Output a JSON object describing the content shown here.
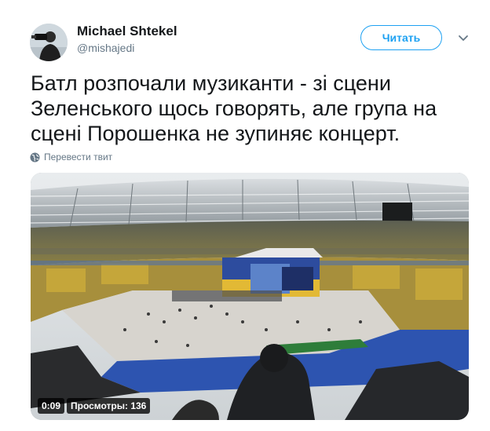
{
  "author": {
    "name": "Michael Shtekel",
    "handle": "@mishajedi"
  },
  "follow_button": {
    "label": "Читать"
  },
  "tweet": {
    "lines": [
      "Батл розпочали музиканти - зі сцени",
      "Зеленського щось говорять, але група на",
      "сцені Порошенка не зупиняє концерт."
    ]
  },
  "translate": {
    "label": "Перевести твит"
  },
  "video": {
    "duration": "0:09",
    "views": "Просмотры: 136"
  },
  "colors": {
    "accent": "#1da1f2",
    "secondary_text": "#657786",
    "primary_text": "#14171a"
  },
  "icons": {
    "caret": "chevron-down-icon",
    "translate": "globe-icon"
  }
}
